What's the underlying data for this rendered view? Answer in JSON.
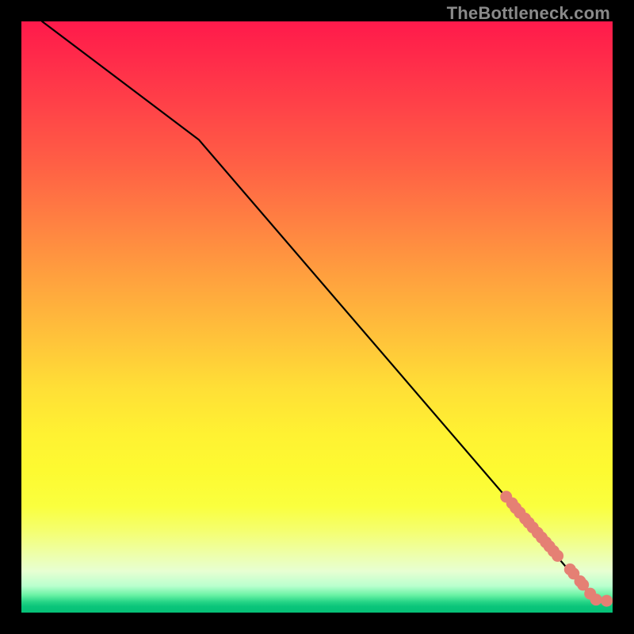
{
  "watermark": "TheBottleneck.com",
  "colors": {
    "line": "#000000",
    "marker_fill": "#e58074",
    "marker_stroke": "#c46a60"
  },
  "chart_data": {
    "type": "line",
    "title": "",
    "xlabel": "",
    "ylabel": "",
    "xlim": [
      0,
      100
    ],
    "ylim": [
      0,
      100
    ],
    "grid": false,
    "legend": false,
    "series": [
      {
        "name": "curve",
        "x": [
          3.5,
          30,
          96,
          97.5,
          99
        ],
        "y": [
          100,
          80,
          3.2,
          2.2,
          2.0
        ],
        "style": "line"
      },
      {
        "name": "markers-cluster",
        "style": "scatter",
        "x": [
          82.0,
          83.0,
          83.6,
          84.3,
          85.2,
          85.8,
          86.5,
          87.3,
          88.0,
          88.7,
          89.3,
          90.0,
          90.7,
          92.8,
          93.4,
          94.5,
          95.0,
          96.2,
          97.2,
          99.0
        ],
        "y": [
          19.6,
          18.5,
          17.7,
          16.9,
          15.9,
          15.2,
          14.4,
          13.5,
          12.7,
          11.9,
          11.2,
          10.4,
          9.6,
          7.3,
          6.6,
          5.3,
          4.7,
          3.2,
          2.2,
          2.0
        ]
      }
    ]
  }
}
